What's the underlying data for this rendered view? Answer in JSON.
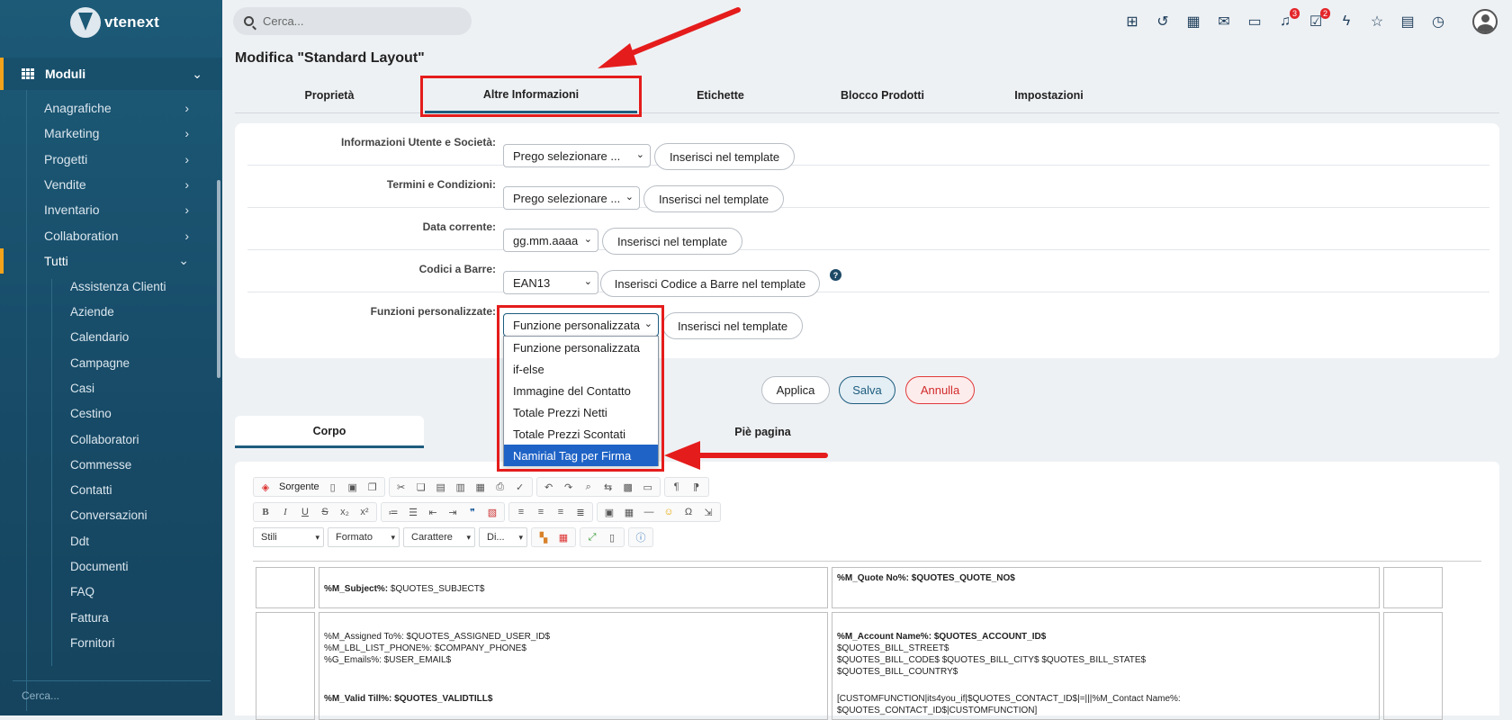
{
  "brand": {
    "name": "vtenext"
  },
  "sidebar": {
    "section": "Moduli",
    "items": [
      {
        "label": "Anagrafiche",
        "expandable": true
      },
      {
        "label": "Marketing",
        "expandable": true
      },
      {
        "label": "Progetti",
        "expandable": true
      },
      {
        "label": "Vendite",
        "expandable": true
      },
      {
        "label": "Inventario",
        "expandable": true
      },
      {
        "label": "Collaboration",
        "expandable": true
      },
      {
        "label": "Tutti",
        "expandable": true,
        "active": true
      }
    ],
    "subitems": [
      "Assistenza Clienti",
      "Aziende",
      "Calendario",
      "Campagne",
      "Casi",
      "Cestino",
      "Collaboratori",
      "Commesse",
      "Contatti",
      "Conversazioni",
      "Ddt",
      "Documenti",
      "FAQ",
      "Fattura",
      "Fornitori"
    ],
    "search_placeholder": "Cerca..."
  },
  "topbar": {
    "search_placeholder": "Cerca...",
    "icons": [
      "hierarchy-icon",
      "history-icon",
      "calendar-icon",
      "mail-icon",
      "chat-icon",
      "bell-icon",
      "tasks-icon",
      "lightning-icon",
      "star-icon",
      "document-icon",
      "timer-icon"
    ],
    "badges": {
      "bell": "3",
      "tasks": "2"
    }
  },
  "page": {
    "title": "Modifica \"Standard Layout\""
  },
  "tabs": [
    "Proprietà",
    "Altre Informazioni",
    "Etichette",
    "Blocco Prodotti",
    "Impostazioni"
  ],
  "form": {
    "rows": [
      {
        "label": "Informazioni Utente e Società:",
        "select": "Prego selezionare ...",
        "button": "Inserisci nel template"
      },
      {
        "label": "Termini e Condizioni:",
        "select": "Prego selezionare ...",
        "button": "Inserisci nel template"
      },
      {
        "label": "Data corrente:",
        "select": "gg.mm.aaaa",
        "button": "Inserisci nel template"
      },
      {
        "label": "Codici a Barre:",
        "select": "EAN13",
        "button": "Inserisci Codice a Barre nel template"
      },
      {
        "label": "Funzioni personalizzate:",
        "select": "Funzione personalizzata",
        "button": "Inserisci nel template"
      }
    ],
    "help": "?",
    "dropdown_options": [
      "Funzione personalizzata",
      "if-else",
      "Immagine del Contatto",
      "Totale Prezzi Netti",
      "Totale Prezzi Scontati",
      "Namirial Tag per Firma"
    ],
    "dropdown_selected_index": 5
  },
  "actions": {
    "apply": "Applica",
    "save": "Salva",
    "cancel": "Annulla"
  },
  "body_tabs": [
    "Corpo",
    "Piè pagina"
  ],
  "editor": {
    "source_label": "Sorgente",
    "combos": [
      "Stili",
      "Formato",
      "Carattere",
      "Di..."
    ],
    "cells": {
      "subject_label": "%M_Subject%:",
      "subject_value": "$QUOTES_SUBJECT$",
      "quote_no_label": "%M_Quote No%:",
      "quote_no_value": "$QUOTES_QUOTE_NO$",
      "assigned_line1": "%M_Assigned To%: $QUOTES_ASSIGNED_USER_ID$",
      "assigned_line2": "%M_LBL_LIST_PHONE%: $COMPANY_PHONE$",
      "assigned_line3": "%G_Emails%: $USER_EMAIL$",
      "account_label": "%M_Account Name%:",
      "account_value": "$QUOTES_ACCOUNT_ID$",
      "bill_line1": "$QUOTES_BILL_STREET$",
      "bill_line2": "$QUOTES_BILL_CODE$ $QUOTES_BILL_CITY$ $QUOTES_BILL_STATE$",
      "bill_line3": "$QUOTES_BILL_COUNTRY$",
      "valid_label": "%M_Valid Till%:",
      "valid_value": "$QUOTES_VALIDTILL$",
      "custom_line1": "[CUSTOMFUNCTION|its4you_if|$QUOTES_CONTACT_ID$|=|||%M_Contact Name%:",
      "custom_line2": "$QUOTES_CONTACT_ID$|CUSTOMFUNCTION]"
    }
  },
  "colors": {
    "sidebar": "#1c5a77",
    "accent": "#f2a31b",
    "highlight": "#e51c1c",
    "selected": "#1f63c6"
  }
}
